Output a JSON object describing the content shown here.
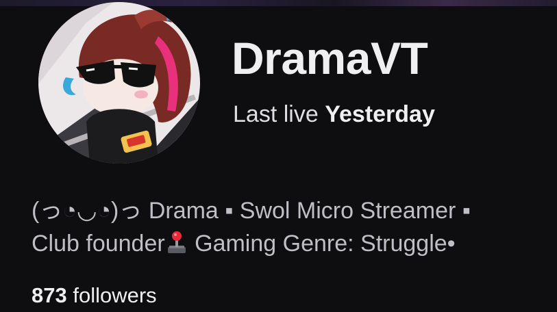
{
  "channel": {
    "name": "DramaVT",
    "last_live_label": "Last live",
    "last_live_value": "Yesterday"
  },
  "bio": {
    "line1": "(っ◔◡◔)っ Drama ▪ Swol Micro Streamer ▪",
    "line2_a": "Club founder",
    "line2_icon": "joystick-icon",
    "line2_b": " Gaming Genre: Struggle•"
  },
  "followers": {
    "count": "873",
    "label": "followers"
  },
  "colors": {
    "background": "#0e0e10",
    "text_primary": "#efeff1",
    "text_secondary": "#bfbfc6"
  }
}
